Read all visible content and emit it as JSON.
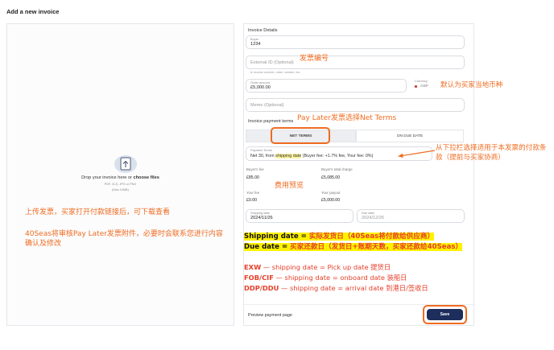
{
  "page": {
    "title": "Add a new invoice"
  },
  "upload": {
    "drop_text": "Drop your invoice here or ",
    "choose_files": "choose files",
    "types": "PDF, XLS, JPG or PNG",
    "max": "(Max 10MB)"
  },
  "annotations": {
    "upload_note_1": "上传发票，买家打开付款链接后，可下载查看",
    "upload_note_2": "40Seas将审核Pay Later发票附件，必要时会联系您进行内容确认及修改",
    "invoice_number": "发票编号",
    "currency": "默认为买家当地币种",
    "net_terms": "Pay Later发票选择Net Terms",
    "dropdown": "从下拉栏选择适用于本发票的付款条款（提前与买家协商）",
    "fees": "费用预览"
  },
  "form": {
    "section_invoice_details": "Invoice Details",
    "buyer_label": "Buyer",
    "buyer_value": "1234",
    "external_id_placeholder": "External ID (Optional)",
    "external_id_helper": "ie invoice number, order number, etc.",
    "order_amount_label": "Order amount",
    "order_amount_value": "£5,000.00",
    "currency_label": "Currency",
    "currency_value": "GBP",
    "memo_placeholder": "Memo (Optional)",
    "section_payment_terms": "Invoice payment terms",
    "tab_net_terms": "NET TERMS",
    "tab_on_due_date": "ON DUE DATE",
    "payment_terms_label": "Payment Terms",
    "payment_terms_prefix": "Net 30, from ",
    "payment_terms_highlight": "shipping date",
    "payment_terms_suffix": " (Buyer fee: +1.7% fee, Your fee: 0%)",
    "buyers_fee_label": "Buyer's fee",
    "buyers_fee_value": "£85.00",
    "buyers_total_label": "Buyer's total charge",
    "buyers_total_value": "£5,085.00",
    "your_fee_label": "Your fee",
    "your_fee_value": "£0.00",
    "your_payout_label": "Your payout",
    "your_payout_value": "£5,000.00",
    "shipping_date_label": "Shipping date",
    "shipping_date_value": "2024/11/26",
    "due_date_label": "Due date",
    "due_date_value": "2024/12/26",
    "preview_link": "Preview payment page",
    "save_button": "Save"
  },
  "explain": {
    "shipping_key": "Shipping date = ",
    "shipping_val": "实际发货日（40Seas将付款给供应商）",
    "due_key": "Due date = ",
    "due_val": "买家还款日（发货日+账期天数，买家还款给40Seas）",
    "exw_key": "EXW",
    "exw_val": " — shipping date = Pick up date 提货日",
    "fob_key": "FOB/CIF",
    "fob_val": " — shipping date = onboard date 装船日",
    "ddp_key": "DDP/DDU",
    "ddp_val": " — shipping date = arrival date 到港日/签收日"
  },
  "colors": {
    "accent": "#ef6c21",
    "button": "#1d2d5c",
    "highlight": "#fff200",
    "red": "#e53e2a"
  }
}
